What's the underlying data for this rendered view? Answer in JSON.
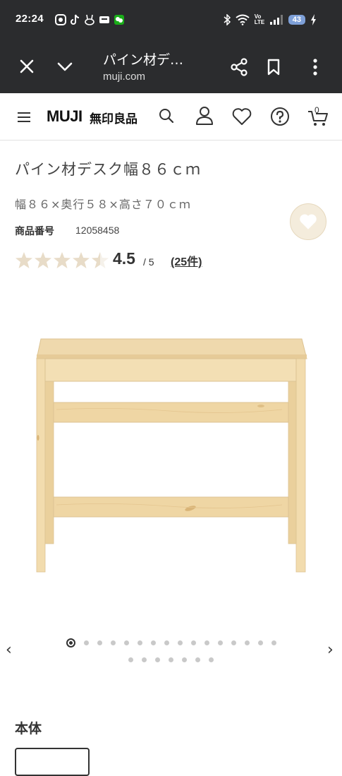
{
  "status_bar": {
    "time": "22:24",
    "volte": "Vo LTE",
    "battery": "43",
    "icons_left": [
      "app-icon",
      "tiktok-icon",
      "bunny-app-icon",
      "message-icon",
      "wechat-icon"
    ],
    "icons_right": [
      "bluetooth-icon",
      "wifi-icon",
      "volte-icon",
      "signal-icon",
      "battery-icon",
      "charging-icon"
    ]
  },
  "browser_toolbar": {
    "title": "パイン材デ…",
    "url": "muji.com",
    "icons": [
      "close-icon",
      "chevron-down-icon",
      "share-icon",
      "bookmark-icon",
      "more-icon"
    ]
  },
  "site_header": {
    "logo_en": "MUJI",
    "logo_jp": "無印良品",
    "cart_count": "0",
    "icons": [
      "menu-icon",
      "search-icon",
      "account-icon",
      "heart-icon",
      "help-icon",
      "cart-icon"
    ]
  },
  "product": {
    "title": "パイン材デスク幅８６ｃｍ",
    "subtitle": "幅８６×奥行５８×高さ７０ｃｍ",
    "number_label": "商品番号",
    "number": "12058458",
    "rating": "4.5",
    "rating_max": "/ 5",
    "review_count": "(25件)",
    "rating_value": 4.5,
    "rating_scale": 5,
    "star_color": "#e8dcc8"
  },
  "gallery": {
    "total_images": 23,
    "current_index": 1,
    "prev_label": "‹",
    "next_label": "›"
  },
  "variants": {
    "section_title": "本体"
  },
  "colors": {
    "browser_bar": "#2b2c2e",
    "favorite_bg": "#f4ecdc",
    "wood": "#f1d9a8"
  }
}
